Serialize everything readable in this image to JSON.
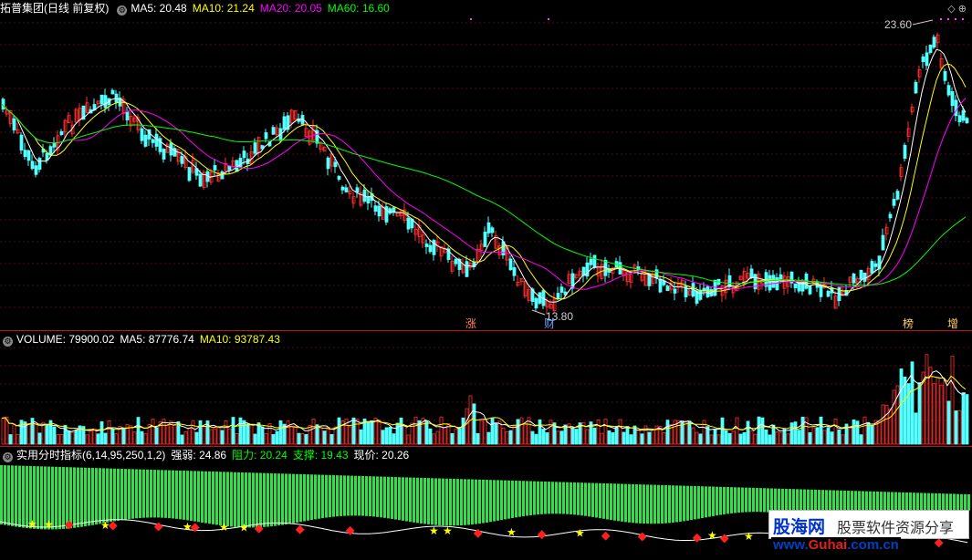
{
  "price_panel": {
    "title": "拓普集团(日线 前复权)",
    "ma5": "MA5: 20.48",
    "ma10": "MA10: 21.24",
    "ma20": "MA20: 20.05",
    "ma60": "MA60: 16.60",
    "high_label": "23.60",
    "low_label": "13.80",
    "markers": [
      "涨",
      "财",
      "榜",
      "增"
    ],
    "colors": {
      "ma5": "#ffffff",
      "ma10": "#ffff00",
      "ma20": "#ff00ff",
      "ma60": "#00ff00",
      "up": "#ff3030",
      "down": "#54ffff"
    }
  },
  "volume_panel": {
    "title": "VOLUME: 79900.02",
    "ma5": "MA5: 87776.74",
    "ma10": "MA10: 93787.43"
  },
  "indicator_panel": {
    "title": "实用分时指标(6,14,95,250,1,2)",
    "strength": "强弱: 24.86",
    "resistance": "阻力: 20.24",
    "support": "支撑: 19.43",
    "current": "现价: 20.26"
  },
  "watermark": {
    "logo": "股海网",
    "slogan": "股票软件资源分享",
    "url_part1": "www.",
    "url_part2": "Guhai",
    "url_part3": ".com.cn"
  },
  "icons": [
    "settings-icon",
    "diamond-icon",
    "expand-icon"
  ]
}
